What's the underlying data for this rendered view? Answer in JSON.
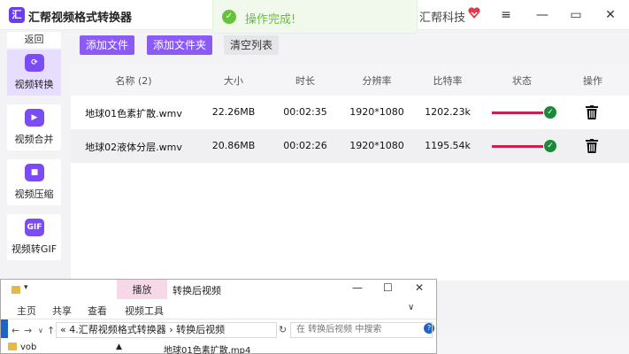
{
  "app": {
    "logo_glyph": "汇",
    "title": "汇帮视频格式转换器",
    "brand": "汇帮科技",
    "window_controls": {
      "menu": "≡",
      "minimize": "—",
      "maximize": "▭",
      "close": "✕"
    }
  },
  "toast": {
    "text": "操作完成!"
  },
  "sidebar": {
    "back": "返回",
    "items": [
      {
        "label": "视频转换",
        "active": true
      },
      {
        "label": "视频合并",
        "active": false
      },
      {
        "label": "视频压缩",
        "active": false
      },
      {
        "label": "视频转GIF",
        "active": false
      }
    ]
  },
  "toolbar": {
    "add_file": "添加文件",
    "add_folder": "添加文件夹",
    "clear_list": "清空列表"
  },
  "table": {
    "columns": [
      "名称 (2)",
      "大小",
      "时长",
      "分辨率",
      "比特率",
      "状态",
      "操作"
    ],
    "rows": [
      {
        "name": "地球01色素扩散.wmv",
        "size": "22.26MB",
        "duration": "00:02:35",
        "resolution": "1920*1080",
        "bitrate": "1202.23k",
        "progress": 1.0
      },
      {
        "name": "地球02液体分层.wmv",
        "size": "20.86MB",
        "duration": "00:02:26",
        "resolution": "1920*1080",
        "bitrate": "1195.54k",
        "progress": 1.0
      }
    ]
  },
  "explorer": {
    "ribbon_context_tab": "播放",
    "title": "转换后视频",
    "tabs": [
      "主页",
      "共享",
      "查看",
      "视频工具"
    ],
    "address": "« 4.汇帮视频格式转换器 › 转换后视频",
    "search_placeholder": "在 转换后视频 中搜索",
    "left_item": "vob",
    "file_item": "地球01色素扩散.mp4"
  },
  "colors": {
    "accent": "#8a5cf5",
    "progress": "#cc1f4d",
    "success": "#1a8a3a",
    "toast": "#67c23a"
  }
}
